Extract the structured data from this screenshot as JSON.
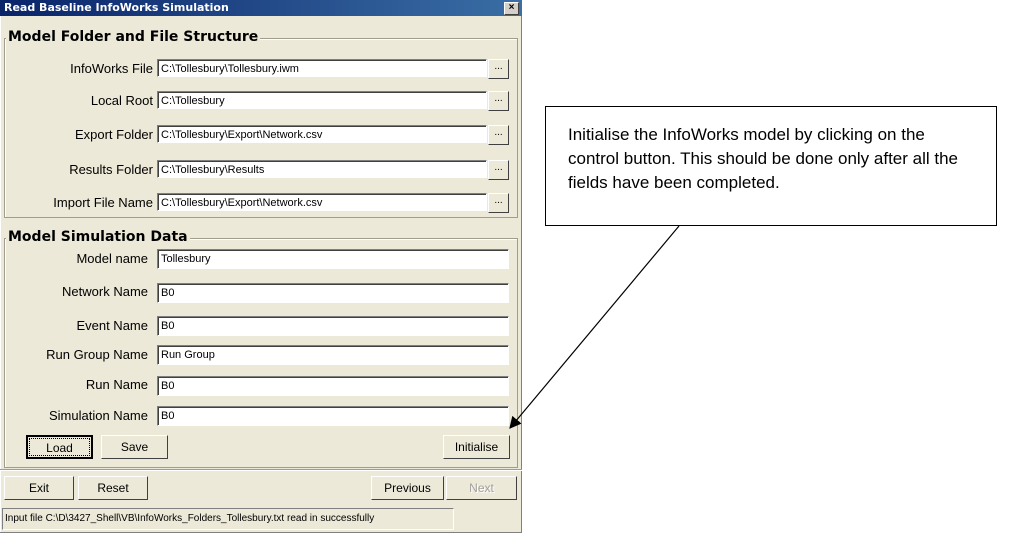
{
  "window": {
    "title": "Read Baseline InfoWorks Simulation",
    "close_glyph": "×"
  },
  "group_model_folder": {
    "legend": "Model Folder and File Structure",
    "rows": [
      {
        "label": "InfoWorks File",
        "value": "C:\\Tollesbury\\Tollesbury.iwm",
        "browse": "..."
      },
      {
        "label": "Local Root",
        "value": "C:\\Tollesbury",
        "browse": "..."
      },
      {
        "label": "Export Folder",
        "value": "C:\\Tollesbury\\Export\\Network.csv",
        "browse": "..."
      },
      {
        "label": "Results Folder",
        "value": "C:\\Tollesbury\\Results",
        "browse": "..."
      },
      {
        "label": "Import File Name",
        "value": "C:\\Tollesbury\\Export\\Network.csv",
        "browse": "..."
      }
    ]
  },
  "group_simulation": {
    "legend": "Model Simulation Data",
    "rows": [
      {
        "label": "Model name",
        "value": "Tollesbury"
      },
      {
        "label": "Network Name",
        "value": "B0"
      },
      {
        "label": "Event Name",
        "value": "B0"
      },
      {
        "label": "Run Group Name",
        "value": "Run Group"
      },
      {
        "label": "Run Name",
        "value": "B0"
      },
      {
        "label": "Simulation Name",
        "value": "B0"
      }
    ],
    "buttons": {
      "load": "Load",
      "save": "Save",
      "initialise": "Initialise"
    }
  },
  "footer": {
    "exit": "Exit",
    "reset": "Reset",
    "previous": "Previous",
    "next": "Next"
  },
  "status": {
    "text": "Input file C:\\D\\3427_Shell\\VB\\InfoWorks_Folders_Tollesbury.txt read in successfully"
  },
  "annotation": {
    "text": "Initialise the InfoWorks model by clicking on the control button. This should be done only after all the fields have been completed."
  }
}
